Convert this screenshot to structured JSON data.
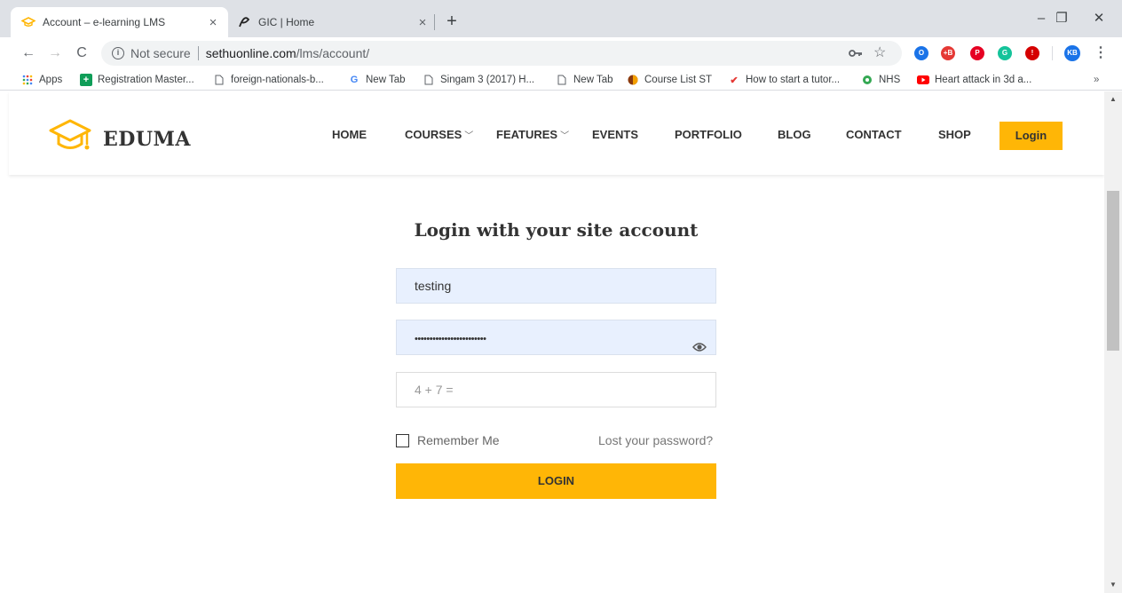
{
  "browser": {
    "tabs": [
      {
        "title": "Account – e-learning LMS",
        "active": true,
        "close": "×"
      },
      {
        "title": "GIC | Home",
        "active": false,
        "close": "×"
      }
    ],
    "new_tab_glyph": "+",
    "window_controls": {
      "minimize": "–",
      "restore": "❐",
      "close": "✕"
    },
    "nav": {
      "back": "←",
      "forward": "→",
      "reload": "C"
    },
    "omnibox": {
      "security": "Not secure",
      "host": "sethuonline.com",
      "path": "/lms/account/"
    },
    "extensions": [
      {
        "name": "opera-ext-icon",
        "color": "#1a73e8",
        "label": "O"
      },
      {
        "name": "kb-ext-icon",
        "color": "#e53935",
        "label": "+B"
      },
      {
        "name": "pinterest-ext-icon",
        "color": "#e60023",
        "label": "P"
      },
      {
        "name": "grammarly-ext-icon",
        "color": "#15c39a",
        "label": "G"
      },
      {
        "name": "adblock-ext-icon",
        "color": "#d50000",
        "label": "!"
      }
    ],
    "profile_initials": "KB",
    "bookmarks": [
      {
        "label": "Apps",
        "icon": "apps-icon"
      },
      {
        "label": "Registration Master...",
        "icon": "sheets-icon"
      },
      {
        "label": "foreign-nationals-b...",
        "icon": "page-icon"
      },
      {
        "label": "New Tab",
        "icon": "google-icon"
      },
      {
        "label": "Singam 3 (2017) H...",
        "icon": "page-icon"
      },
      {
        "label": "New Tab",
        "icon": "page-icon"
      },
      {
        "label": "Course List ST",
        "icon": "course-icon"
      },
      {
        "label": "How to start a tutor...",
        "icon": "tutor-icon"
      },
      {
        "label": "NHS",
        "icon": "nhs-icon"
      },
      {
        "label": "Heart attack in 3d a...",
        "icon": "youtube-icon"
      }
    ],
    "bookmarks_overflow": "»"
  },
  "site": {
    "logo_text": "EDUMA",
    "menu": [
      {
        "label": "HOME",
        "dropdown": false
      },
      {
        "label": "COURSES",
        "dropdown": true
      },
      {
        "label": "FEATURES",
        "dropdown": true
      },
      {
        "label": "EVENTS",
        "dropdown": false
      },
      {
        "label": "PORTFOLIO",
        "dropdown": false
      },
      {
        "label": "BLOG",
        "dropdown": false
      },
      {
        "label": "CONTACT",
        "dropdown": false
      },
      {
        "label": "SHOP",
        "dropdown": false
      }
    ],
    "login_button": "Login",
    "accent_color": "#ffb606"
  },
  "form": {
    "title": "Login with your site account",
    "username_value": "testing",
    "password_value": "••••••••••••••••••••••••",
    "captcha_placeholder": "4 + 7 =",
    "remember_label": "Remember Me",
    "lost_password": "Lost your password?",
    "submit_label": "LOGIN"
  }
}
